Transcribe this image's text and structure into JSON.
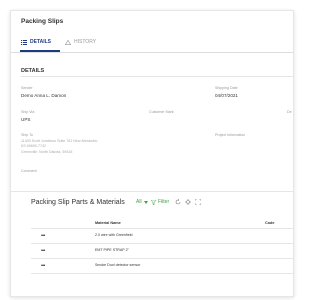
{
  "page": {
    "title": "Packing Slips"
  },
  "tabs": [
    {
      "label": "DETAILS",
      "icon": "list-icon",
      "active": true
    },
    {
      "label": "HISTORY",
      "icon": "warning-icon",
      "active": false
    }
  ],
  "details": {
    "heading": "DETAILS",
    "sender_label": "Sender",
    "sender_value": "Demo Anna L. Damon",
    "shipping_date_label": "Shipping Date",
    "shipping_date_value": "04/07/2021",
    "ship_via_label": "Ship Via",
    "ship_via_value": "UPS",
    "customer_mark_label": "Customer Mark",
    "cut_label": "De",
    "ship_to_label": "Ship To",
    "ship_to_line1": "11400 Scott Junctions Suite 761 New Alexander,",
    "ship_to_line2": "KS 69690-7742",
    "ship_to_line3": "Greenville, North Dakota, 59426",
    "project_info_label": "Project Information",
    "comment_label": "Comment"
  },
  "parts": {
    "title": "Packing Slip Parts & Materials",
    "all_label": "All",
    "filter_label": "Filter",
    "columns": {
      "material": "Material Name",
      "code": "Code"
    },
    "rows": [
      {
        "menu": "•••",
        "material": "2.0 wire with Greenfield"
      },
      {
        "menu": "•••",
        "material": "EMT PIPE STRAP 2\""
      },
      {
        "menu": "•••",
        "material": "Smoke Duct detector sensor"
      }
    ]
  },
  "colors": {
    "accent": "#1f3b82",
    "green": "#43a047"
  }
}
